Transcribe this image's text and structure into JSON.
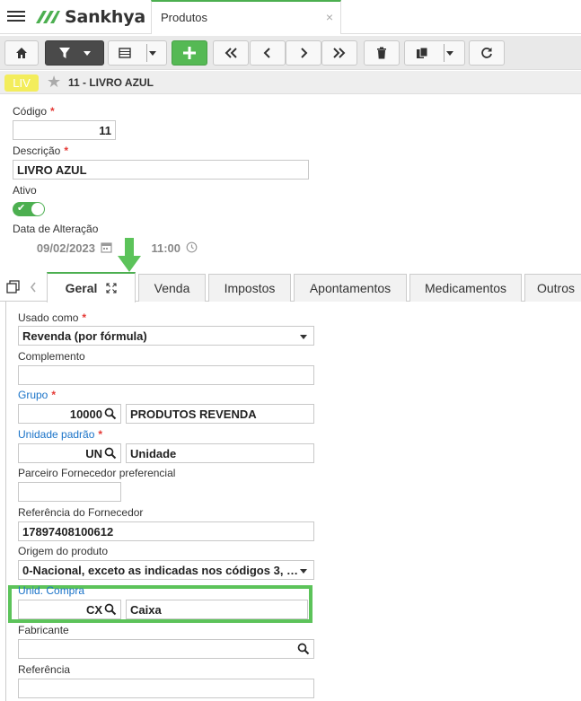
{
  "app": {
    "logo": "Sankhya",
    "tab_title": "Produtos",
    "tab_close": "×"
  },
  "record": {
    "badge": "LIV",
    "title": "11 - LIVRO AZUL"
  },
  "form": {
    "codigo_label": "Código",
    "codigo_value": "11",
    "descricao_label": "Descrição",
    "descricao_value": "LIVRO AZUL",
    "ativo_label": "Ativo",
    "ativo_value": true,
    "data_label": "Data de Alteração",
    "data_value": "09/02/2023",
    "hora_value": "11:00",
    "required_mark": "*"
  },
  "tabs": [
    {
      "label": "Geral"
    },
    {
      "label": "Venda"
    },
    {
      "label": "Impostos"
    },
    {
      "label": "Apontamentos"
    },
    {
      "label": "Medicamentos"
    },
    {
      "label": "Outros"
    }
  ],
  "geral": {
    "usado_como_label": "Usado como",
    "usado_como_value": "Revenda (por fórmula)",
    "complemento_label": "Complemento",
    "complemento_value": "",
    "grupo_label": "Grupo",
    "grupo_code": "10000",
    "grupo_desc": "PRODUTOS REVENDA",
    "unidade_label": "Unidade padrão",
    "unidade_code": "UN",
    "unidade_desc": "Unidade",
    "parceiro_label": "Parceiro Fornecedor preferencial",
    "parceiro_value": "",
    "referencia_forn_label": "Referência do Fornecedor",
    "referencia_forn_value": "17897408100612",
    "origem_label": "Origem do produto",
    "origem_value": "0-Nacional, exceto as indicadas nos códigos 3, …",
    "unid_compra_label": "Unid. Compra",
    "unid_compra_code": "CX",
    "unid_compra_desc": "Caixa",
    "fabricante_label": "Fabricante",
    "fabricante_value": "",
    "referencia_label": "Referência",
    "referencia_value": ""
  },
  "colors": {
    "accent": "#4caf50",
    "badge": "#f3ed5c",
    "link": "#1a73c8",
    "required": "#e53935",
    "highlight": "#5cc35a"
  }
}
